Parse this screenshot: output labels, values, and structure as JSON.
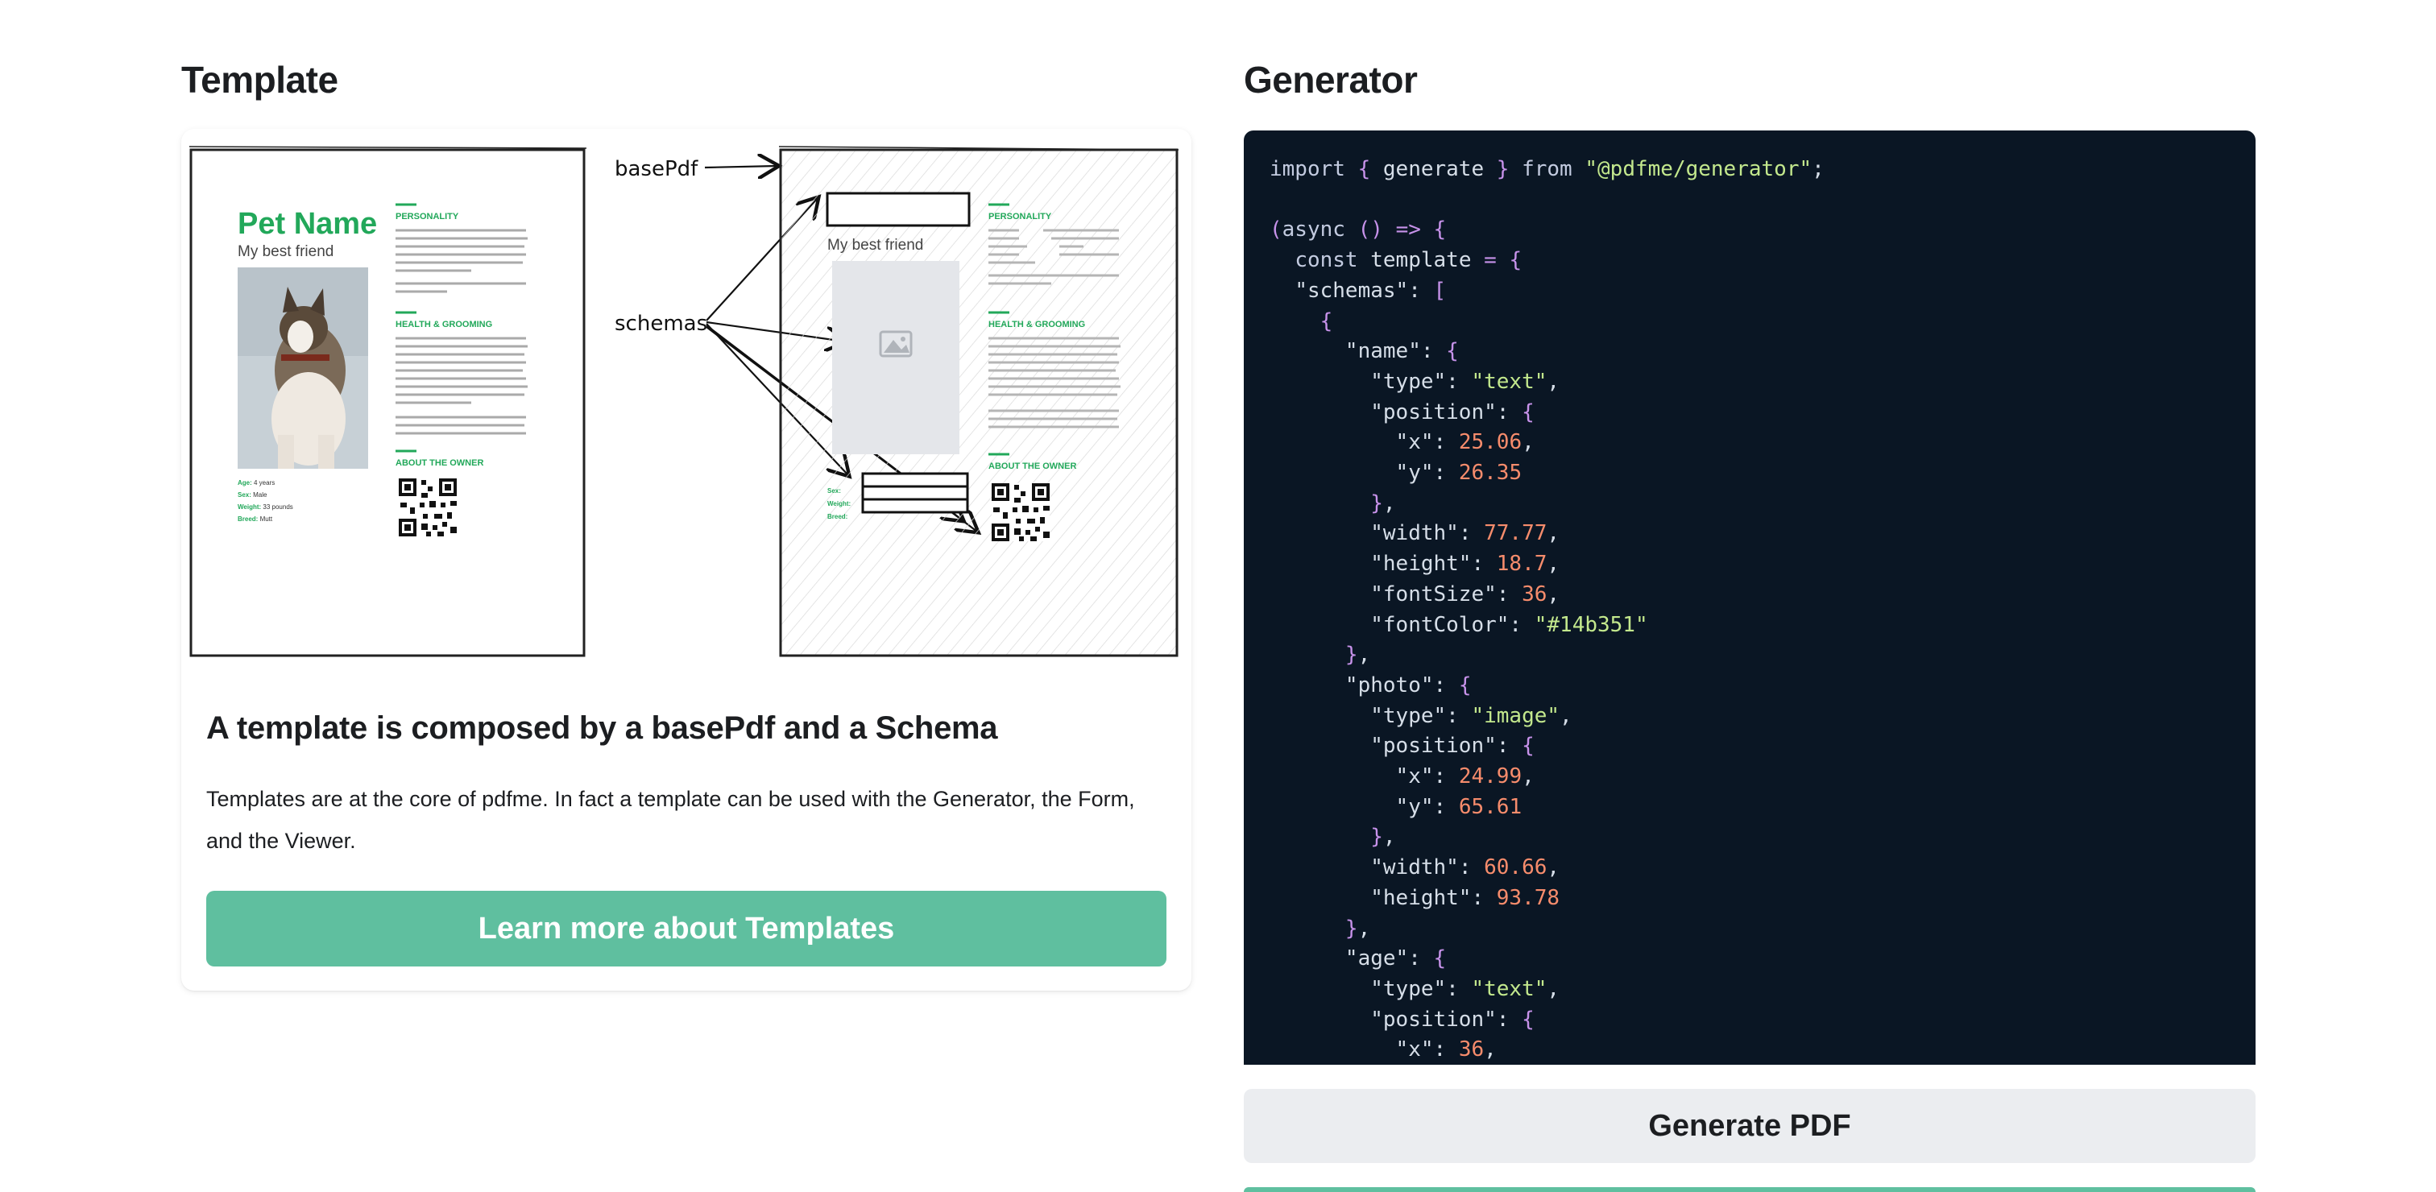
{
  "template_section": {
    "title": "Template",
    "illustration": {
      "pet_name": "Pet Name",
      "subtitle": "My best friend",
      "personality": "PERSONALITY",
      "health": "HEALTH & GROOMING",
      "owner": "ABOUT THE OWNER",
      "basepdf_label": "basePdf",
      "schemas_label": "schemas",
      "info_lines": [
        "Age: 4 years",
        "Sex: Male",
        "Weight: 33 pounds",
        "Breed: Mutt"
      ],
      "right_info_lines": [
        "Sex:",
        "Weight:",
        "Breed:"
      ],
      "accent_color": "#22a85a"
    },
    "card": {
      "heading": "A template is composed by a basePdf and a Schema",
      "description": "Templates are at the core of pdfme. In fact a template can be used with the Generator, the Form, and the Viewer.",
      "button_label": "Learn more about Templates",
      "button_color": "#5fbf9f"
    }
  },
  "generator_section": {
    "title": "Generator",
    "code_lines": [
      "import { generate } from \"@pdfme/generator\";",
      "",
      "(async () => {",
      "  const template = {",
      "  \"schemas\": [",
      "    {",
      "      \"name\": {",
      "        \"type\": \"text\",",
      "        \"position\": {",
      "          \"x\": 25.06,",
      "          \"y\": 26.35",
      "        },",
      "        \"width\": 77.77,",
      "        \"height\": 18.7,",
      "        \"fontSize\": 36,",
      "        \"fontColor\": \"#14b351\"",
      "      },",
      "      \"photo\": {",
      "        \"type\": \"image\",",
      "        \"position\": {",
      "          \"x\": 24.99,",
      "          \"y\": 65.61",
      "        },",
      "        \"width\": 60.66,",
      "        \"height\": 93.78",
      "      },",
      "      \"age\": {",
      "        \"type\": \"text\",",
      "        \"position\": {",
      "          \"x\": 36,"
    ],
    "generate_button": "Generate PDF",
    "code_bg": "#0a1624"
  }
}
